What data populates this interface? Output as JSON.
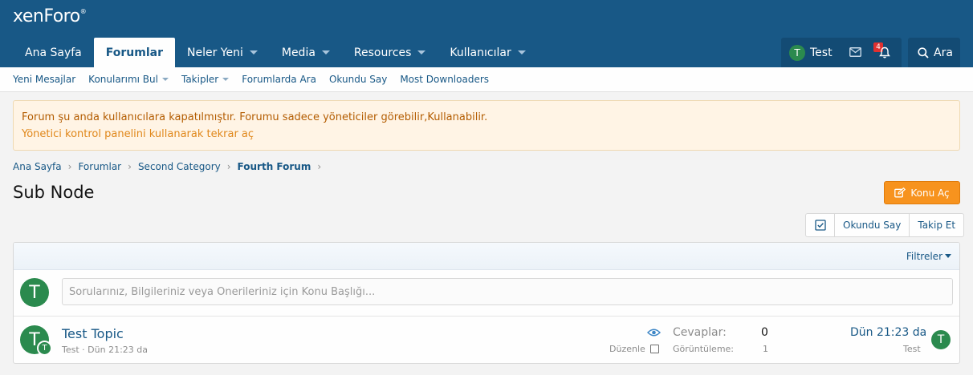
{
  "header": {
    "logo": "xenForo",
    "logo_mark": "®",
    "nav": [
      {
        "label": "Ana Sayfa",
        "active": false,
        "caret": false
      },
      {
        "label": "Forumlar",
        "active": true,
        "caret": false
      },
      {
        "label": "Neler Yeni",
        "active": false,
        "caret": true
      },
      {
        "label": "Media",
        "active": false,
        "caret": true
      },
      {
        "label": "Resources",
        "active": false,
        "caret": true
      },
      {
        "label": "Kullanıcılar",
        "active": false,
        "caret": true
      }
    ],
    "user": {
      "avatar_letter": "T",
      "name": "Test",
      "alert_count": "4"
    },
    "search_label": "Ara"
  },
  "subnav": [
    {
      "label": "Yeni Mesajlar",
      "caret": false
    },
    {
      "label": "Konularımı Bul",
      "caret": true
    },
    {
      "label": "Takipler",
      "caret": true
    },
    {
      "label": "Forumlarda Ara",
      "caret": false
    },
    {
      "label": "Okundu Say",
      "caret": false
    },
    {
      "label": "Most Downloaders",
      "caret": false
    }
  ],
  "notice": {
    "text": "Forum şu anda kullanıcılara kapatılmıştır. Forumu sadece yöneticiler görebilir,Kullanabilir.",
    "link": "Yönetici kontrol panelini kullanarak tekrar aç"
  },
  "breadcrumb": [
    "Ana Sayfa",
    "Forumlar",
    "Second Category",
    "Fourth Forum"
  ],
  "page": {
    "title": "Sub Node",
    "new_thread_label": "Konu Aç",
    "mark_read_label": "Okundu Say",
    "watch_label": "Takip Et"
  },
  "filters_label": "Filtreler",
  "quick_thread": {
    "avatar_letter": "T",
    "placeholder": "Sorularınız, Bilgileriniz veya Önerileriniz için Konu Başlığı..."
  },
  "threads": [
    {
      "title": "Test Topic",
      "avatar_letter": "T",
      "starter": "Test",
      "start_date": "Dün 21:23 da",
      "edit_label": "Düzenle",
      "replies_label": "Cevaplar:",
      "replies": "0",
      "views_label": "Görüntüleme:",
      "views": "1",
      "last_post_date": "Dün 21:23 da",
      "last_poster": "Test",
      "last_avatar_letter": "T"
    }
  ],
  "colors": {
    "header_bg": "#185886",
    "link": "#185886",
    "accent_button": "#f7931e",
    "notice_bg": "#fff4e5",
    "avatar_bg": "#2b8a4e"
  },
  "icons": {
    "mail": "mail-icon",
    "bell": "bell-icon",
    "search": "search-icon",
    "edit": "edit-icon",
    "watch": "eye-icon",
    "select": "checkbox-icon"
  }
}
